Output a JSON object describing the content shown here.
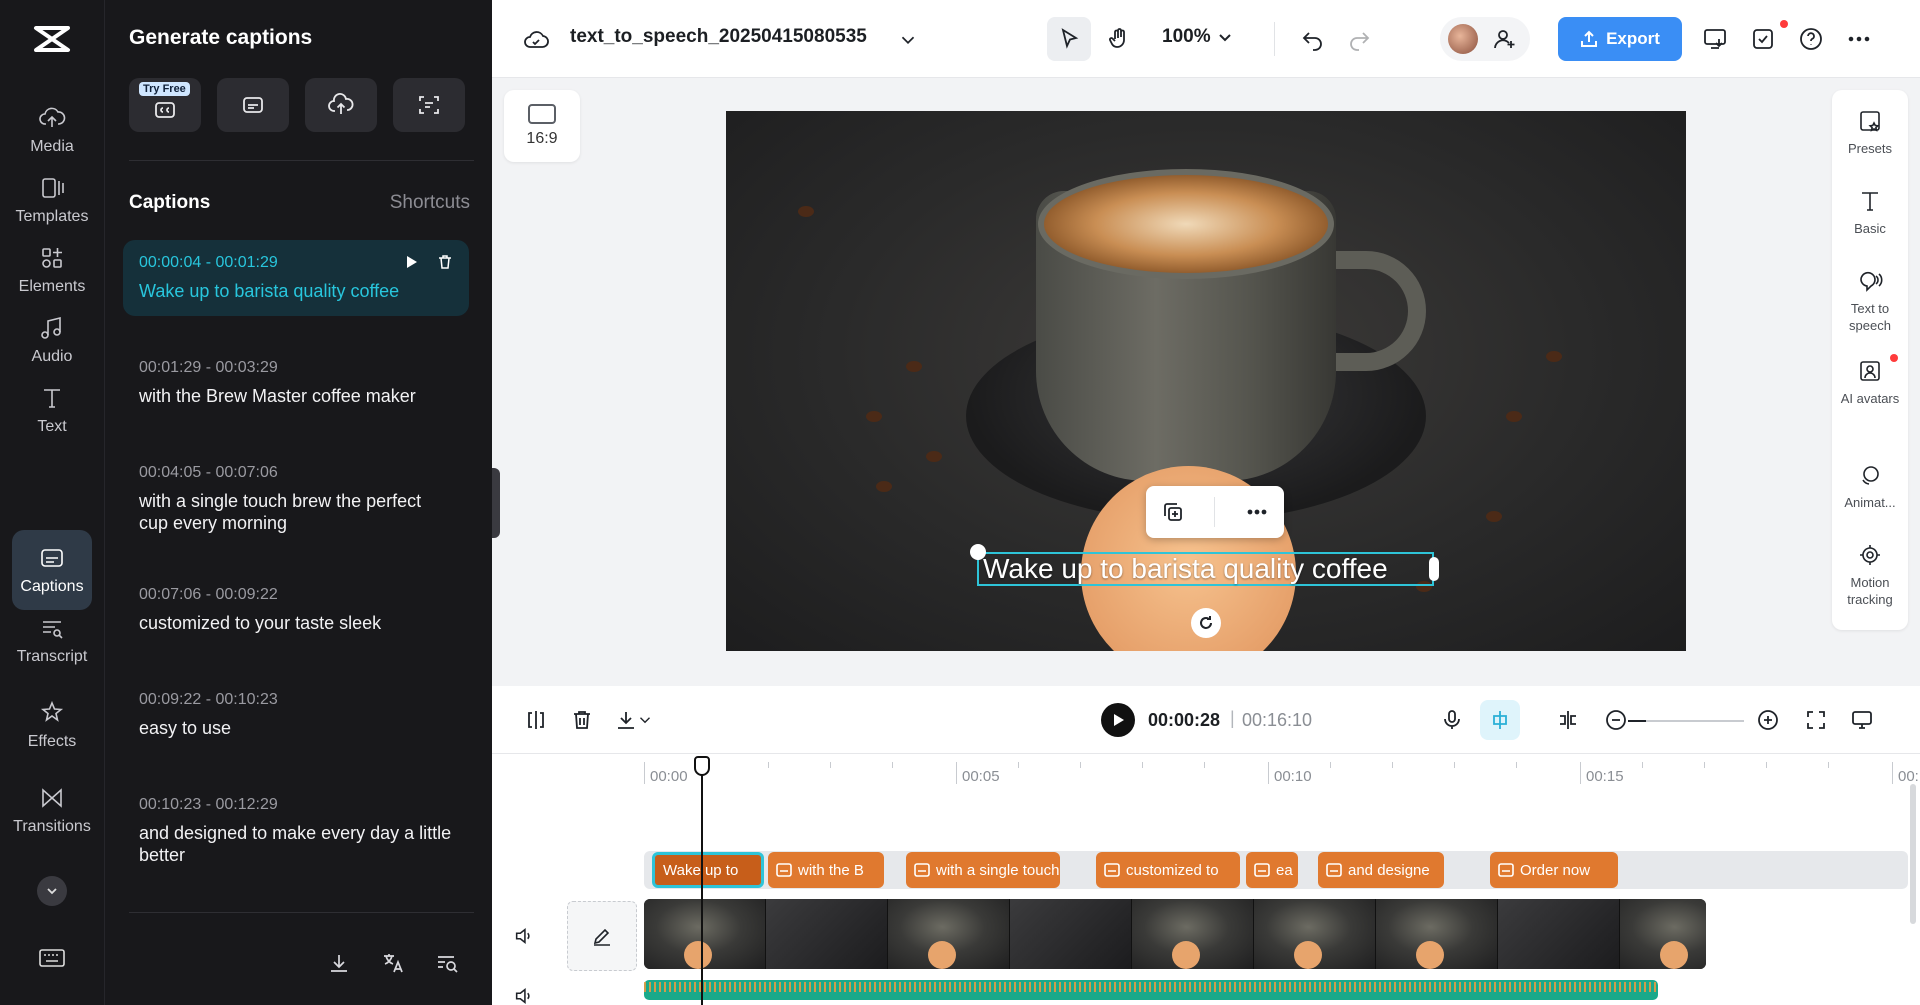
{
  "app": {
    "filename": "text_to_speech_20250415080535",
    "zoom": "100%",
    "export_label": "Export",
    "accent": "#3a8ef5",
    "selection_color": "#2ec4d8"
  },
  "rail": {
    "items": [
      {
        "label": "Media",
        "icon": "cloud-upload-icon"
      },
      {
        "label": "Templates",
        "icon": "templates-icon"
      },
      {
        "label": "Elements",
        "icon": "elements-icon"
      },
      {
        "label": "Audio",
        "icon": "music-note-icon"
      },
      {
        "label": "Text",
        "icon": "text-icon"
      },
      {
        "label": "Captions",
        "icon": "captions-icon",
        "active": true
      },
      {
        "label": "Transcript",
        "icon": "transcript-icon"
      },
      {
        "label": "Effects",
        "icon": "effects-icon"
      },
      {
        "label": "Transitions",
        "icon": "transitions-icon"
      }
    ]
  },
  "panel": {
    "title": "Generate captions",
    "try_free": "Try Free",
    "captions_title": "Captions",
    "shortcuts": "Shortcuts",
    "captions": [
      {
        "time": "00:00:04 - 00:01:29",
        "text": "Wake up to barista quality coffee",
        "active": true
      },
      {
        "time": "00:01:29 - 00:03:29",
        "text": "with the Brew Master coffee maker"
      },
      {
        "time": "00:04:05 - 00:07:06",
        "text": "with a single touch brew the perfect cup every morning"
      },
      {
        "time": "00:07:06 - 00:09:22",
        "text": "customized to your taste sleek"
      },
      {
        "time": "00:09:22 - 00:10:23",
        "text": "easy to use"
      },
      {
        "time": "00:10:23 - 00:12:29",
        "text": "and designed to make every day a little better"
      }
    ]
  },
  "canvas": {
    "ratio": "16:9",
    "caption_overlay": "Wake up to barista quality coffee"
  },
  "right_tools": [
    {
      "label": "Presets",
      "icon": "presets-icon"
    },
    {
      "label": "Basic",
      "icon": "text-basic-icon"
    },
    {
      "label": "Text to speech",
      "icon": "text-to-speech-icon"
    },
    {
      "label": "AI avatars",
      "icon": "ai-avatar-icon"
    },
    {
      "label": "Animat...",
      "icon": "animation-icon"
    },
    {
      "label": "Motion tracking",
      "icon": "motion-tracking-icon"
    }
  ],
  "timeline": {
    "current_time": "00:00:28",
    "separator": "|",
    "total_time": "00:16:10",
    "ruler": [
      "00:00",
      "00:05",
      "00:10",
      "00:15",
      "00:"
    ],
    "clips": [
      {
        "label": "Wake up to"
      },
      {
        "label": "with the B"
      },
      {
        "label": "with a single touch"
      },
      {
        "label": "customized to"
      },
      {
        "label": "ea"
      },
      {
        "label": "and designe"
      },
      {
        "label": "Order now"
      }
    ]
  }
}
